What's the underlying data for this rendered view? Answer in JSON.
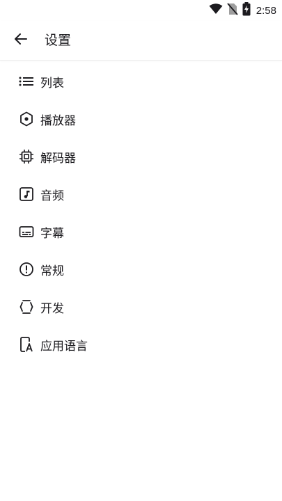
{
  "status_bar": {
    "time": "2:58",
    "icons": [
      "wifi-icon",
      "no-sim-icon",
      "battery-charging-icon"
    ]
  },
  "app_bar": {
    "title": "设置",
    "back_icon": "arrow-back-icon"
  },
  "menu": {
    "items": [
      {
        "label": "列表",
        "icon": "list-icon"
      },
      {
        "label": "播放器",
        "icon": "hexagon-icon"
      },
      {
        "label": "解码器",
        "icon": "chip-icon"
      },
      {
        "label": "音频",
        "icon": "music-note-icon"
      },
      {
        "label": "字幕",
        "icon": "subtitles-icon"
      },
      {
        "label": "常规",
        "icon": "info-circle-icon"
      },
      {
        "label": "开发",
        "icon": "developer-icon"
      },
      {
        "label": "应用语言",
        "icon": "app-language-icon"
      }
    ]
  },
  "colors": {
    "background": "#ffffff",
    "text": "#1c1b1f",
    "divider": "#ececec"
  }
}
